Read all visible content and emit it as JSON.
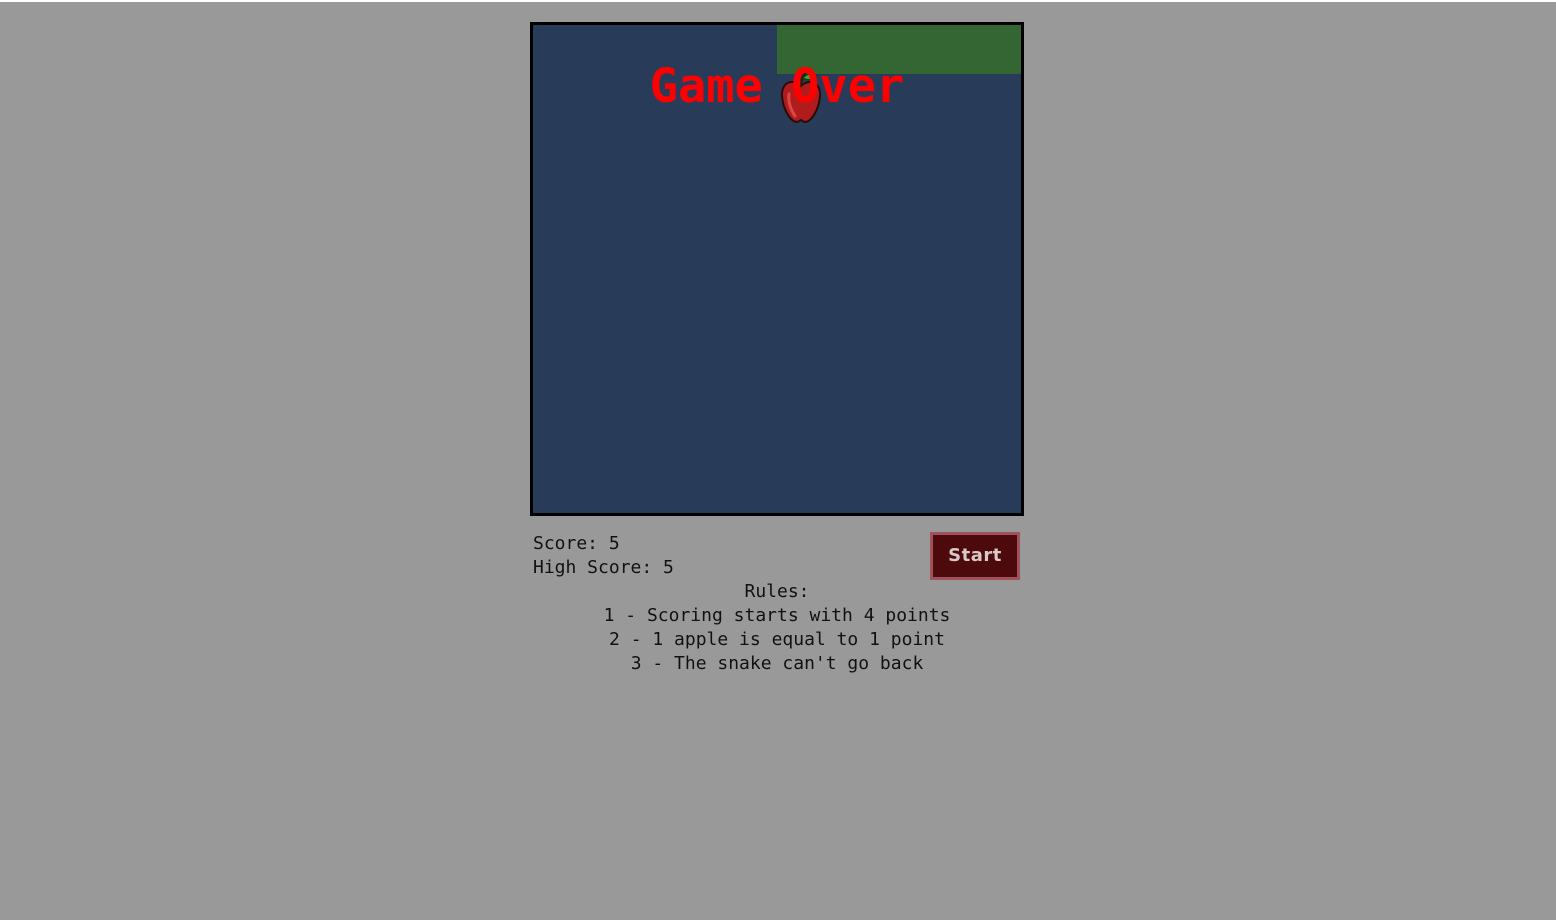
{
  "game": {
    "status_text": "Game Over",
    "colors": {
      "page_background": "#999999",
      "board_background": "#283b59",
      "board_border": "#000000",
      "snake": "#346633",
      "apple": "#b01c1c",
      "game_over_text": "#ff0000"
    },
    "snake_icon": "snake-segment",
    "apple_icon": "apple-icon"
  },
  "scoreboard": {
    "score_label": "Score: 5",
    "high_score_label": "High Score: 5"
  },
  "controls": {
    "start_label": "Start",
    "start_bg": "#4d0a0c",
    "start_border": "#a0515a"
  },
  "rules": {
    "title": "Rules:",
    "items": [
      "1 - Scoring starts with 4 points",
      "2 - 1 apple is equal to 1 point",
      "3 - The snake can't go back"
    ]
  }
}
